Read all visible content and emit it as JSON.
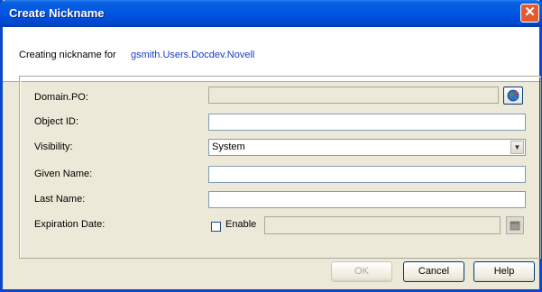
{
  "window": {
    "title": "Create Nickname",
    "close_glyph": "✕"
  },
  "header": {
    "creating_label": "Creating nickname for",
    "user": "gsmith.Users.Docdev.Novell"
  },
  "form": {
    "domain_po": {
      "label": "Domain.PO:",
      "value": ""
    },
    "object_id": {
      "label": "Object ID:",
      "value": ""
    },
    "visibility": {
      "label": "Visibility:",
      "value": "System"
    },
    "given_name": {
      "label": "Given Name:",
      "value": ""
    },
    "last_name": {
      "label": "Last Name:",
      "value": ""
    },
    "expiration": {
      "label": "Expiration Date:",
      "enable_label": "Enable",
      "enabled": false,
      "value": ""
    }
  },
  "icons": {
    "browse": "globe-browse-icon",
    "calendar": "calendar-icon",
    "dropdown": "chevron-down-icon"
  },
  "buttons": {
    "ok": "OK",
    "cancel": "Cancel",
    "help": "Help"
  }
}
